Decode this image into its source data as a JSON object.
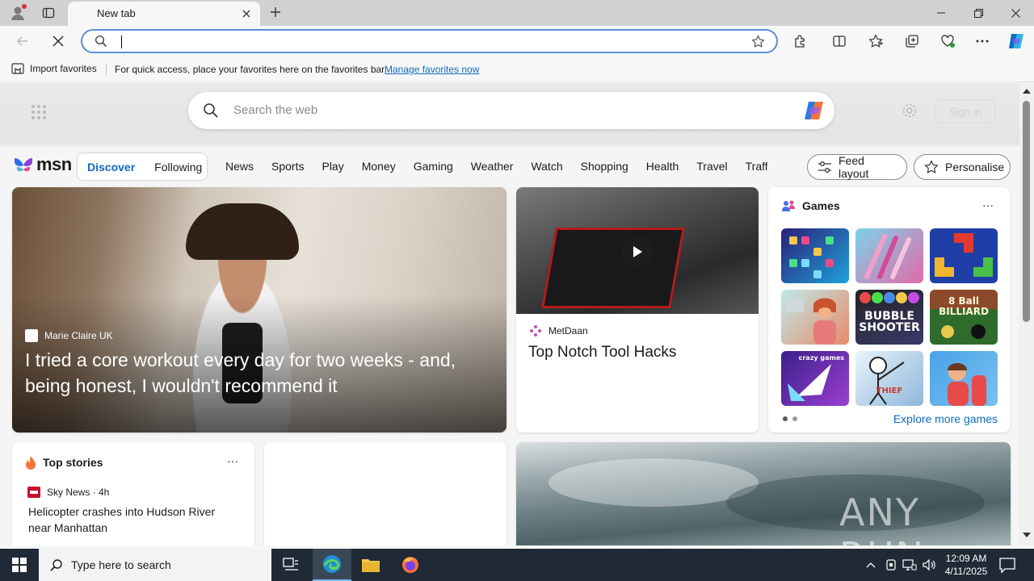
{
  "browser": {
    "tab_title": "New tab",
    "address_value": "",
    "favorites_bar": {
      "import_label": "Import favorites",
      "hint": "For quick access, place your favorites here on the favorites bar.",
      "manage_link": "Manage favorites now"
    },
    "accent": "#0f6cbd"
  },
  "newtab": {
    "search_placeholder": "Search the web",
    "sign_in": "Sign in",
    "brand": "msn",
    "feed_tabs": [
      {
        "label": "Discover",
        "active": true
      },
      {
        "label": "Following",
        "active": false
      }
    ],
    "nav": [
      "News",
      "Sports",
      "Play",
      "Money",
      "Gaming",
      "Weather",
      "Watch",
      "Shopping",
      "Health",
      "Travel",
      "Traffic"
    ],
    "feed_layout": "Feed layout",
    "personalise": "Personalise",
    "hero": {
      "source": "Marie Claire UK",
      "headline": "I tried a core workout every day for two weeks - and, being honest, I wouldn't recommend it"
    },
    "video_card": {
      "source": "MetDaan",
      "headline": "Top Notch Tool Hacks"
    },
    "games": {
      "title": "Games",
      "more": "···",
      "tiles": [
        {
          "label": "",
          "colors": [
            "#2a1f7a",
            "#1fa3d9"
          ]
        },
        {
          "label": "",
          "colors": [
            "#7dd3e8",
            "#e06aa8"
          ]
        },
        {
          "label": "",
          "colors": [
            "#1f3fa6",
            "#e23b2d"
          ]
        },
        {
          "label": "",
          "colors": [
            "#bfe9e8",
            "#e78a6a"
          ]
        },
        {
          "label": "BUBBLE SHOOTER",
          "colors": [
            "#222",
            "#3a78d6"
          ]
        },
        {
          "label": "8 Ball BILLIARD",
          "colors": [
            "#2f5d2a",
            "#a0522d"
          ]
        },
        {
          "label": "crazy games",
          "colors": [
            "#3b1f8a",
            "#9b3fd1"
          ]
        },
        {
          "label": "THIEF",
          "colors": [
            "#cfe6f5",
            "#5a8fc7"
          ]
        },
        {
          "label": "",
          "colors": [
            "#4aa3e8",
            "#e84a4a"
          ]
        }
      ],
      "explore": "Explore more games"
    },
    "top_stories": {
      "title": "Top stories",
      "more": "···",
      "source": "Sky News · 4h",
      "headline": "Helicopter crashes into Hudson River near Manhattan"
    },
    "watermark": "ANY RUN"
  },
  "taskbar": {
    "search_placeholder": "Type here to search",
    "time": "12:09 AM",
    "date": "4/11/2025"
  }
}
